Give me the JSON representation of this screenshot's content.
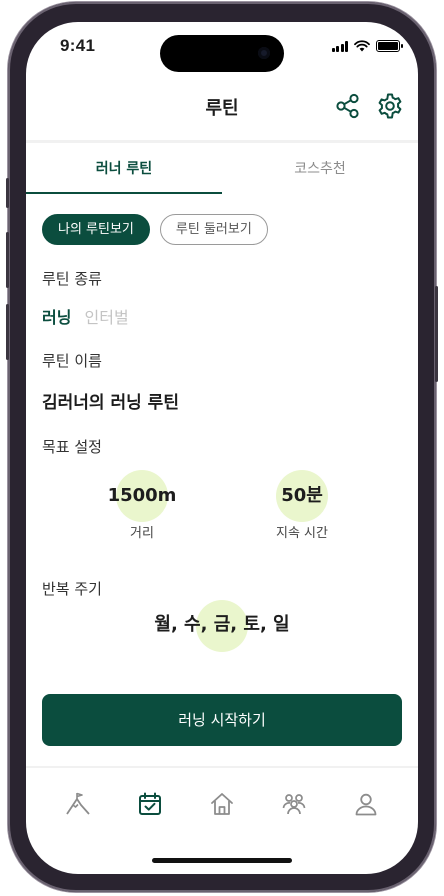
{
  "status_bar": {
    "time": "9:41"
  },
  "header": {
    "title": "루틴",
    "share_icon": "share-icon",
    "settings_icon": "gear-icon"
  },
  "tabs": [
    {
      "label": "러너 루틴",
      "active": true
    },
    {
      "label": "코스추천",
      "active": false
    }
  ],
  "filters": {
    "mine": "나의 루틴보기",
    "browse": "루틴 둘러보기"
  },
  "routine_type": {
    "label": "루틴 종류",
    "selected": "러닝",
    "other": "인터벌"
  },
  "routine_name": {
    "label": "루틴 이름",
    "value": "김러너의 러닝 루틴"
  },
  "goal": {
    "label": "목표 설정",
    "distance": {
      "value": "1500m",
      "label": "거리"
    },
    "duration": {
      "value": "50분",
      "label": "지속 시간"
    }
  },
  "repeat": {
    "label": "반복 주기",
    "days": "월, 수, 금, 토, 일"
  },
  "start_button": "러닝 시작하기",
  "nav": [
    {
      "icon": "mountain-icon",
      "active": false
    },
    {
      "icon": "calendar-check-icon",
      "active": true
    },
    {
      "icon": "home-icon",
      "active": false
    },
    {
      "icon": "community-icon",
      "active": false
    },
    {
      "icon": "profile-icon",
      "active": false
    }
  ],
  "colors": {
    "brand": "#0b4d3e",
    "highlight": "#eaf6cd",
    "muted": "#c4c4c4"
  }
}
